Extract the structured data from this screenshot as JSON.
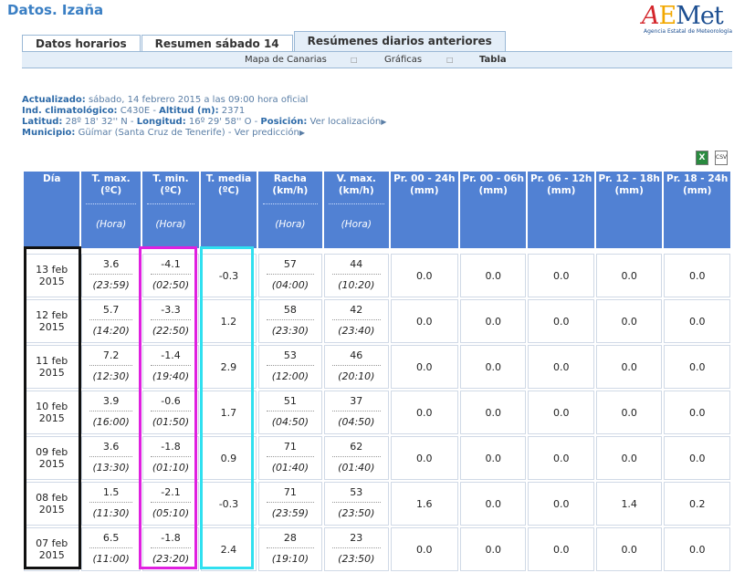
{
  "header": {
    "title": "Datos. Izaña"
  },
  "logo": {
    "sub": "Agencia Estatal de Meteorología"
  },
  "tabs": [
    "Datos horarios",
    "Resumen sábado 14",
    "Resúmenes diarios anteriores"
  ],
  "subnav": {
    "items": [
      "Mapa de Canarias",
      "Gráficas",
      "Tabla"
    ]
  },
  "info": {
    "updated_label": "Actualizado:",
    "updated_value": "sábado, 14 febrero 2015 a las 09:00 hora oficial",
    "ind_label": "Ind. climatológico:",
    "ind_value": "C430E",
    "alt_label": "Altitud (m):",
    "alt_value": "2371",
    "lat_label": "Latitud:",
    "lat_value": "28º 18' 32'' N",
    "lon_label": "Longitud:",
    "lon_value": "16º 29' 58'' O",
    "pos_label": "Posición:",
    "pos_link": "Ver localización",
    "mun_label": "Municipio:",
    "mun_value": "Güímar (Santa Cruz de Tenerife)",
    "pred_link": "Ver predicción"
  },
  "export": {
    "excel": "X",
    "csv": "CSV"
  },
  "table": {
    "headers": {
      "dia": "Día",
      "tmax": "T. max. (ºC)",
      "tmin": "T. min. (ºC)",
      "tmed": "T. media (ºC)",
      "racha": "Racha (km/h)",
      "vmax": "V. max. (km/h)",
      "p1": "Pr. 00 - 24h (mm)",
      "p2": "Pr. 00 - 06h (mm)",
      "p3": "Pr. 06 - 12h (mm)",
      "p4": "Pr. 12 - 18h (mm)",
      "p5": "Pr. 18 - 24h (mm)",
      "hora": "(Hora)"
    },
    "rows": [
      {
        "dia1": "13 feb",
        "dia2": "2015",
        "tmax": "3.6",
        "tmax_h": "(23:59)",
        "tmin": "-4.1",
        "tmin_h": "(02:50)",
        "tmed": "-0.3",
        "racha": "57",
        "racha_h": "(04:00)",
        "vmax": "44",
        "vmax_h": "(10:20)",
        "p1": "0.0",
        "p2": "0.0",
        "p3": "0.0",
        "p4": "0.0",
        "p5": "0.0"
      },
      {
        "dia1": "12 feb",
        "dia2": "2015",
        "tmax": "5.7",
        "tmax_h": "(14:20)",
        "tmin": "-3.3",
        "tmin_h": "(22:50)",
        "tmed": "1.2",
        "racha": "58",
        "racha_h": "(23:30)",
        "vmax": "42",
        "vmax_h": "(23:40)",
        "p1": "0.0",
        "p2": "0.0",
        "p3": "0.0",
        "p4": "0.0",
        "p5": "0.0"
      },
      {
        "dia1": "11 feb",
        "dia2": "2015",
        "tmax": "7.2",
        "tmax_h": "(12:30)",
        "tmin": "-1.4",
        "tmin_h": "(19:40)",
        "tmed": "2.9",
        "racha": "53",
        "racha_h": "(12:00)",
        "vmax": "46",
        "vmax_h": "(20:10)",
        "p1": "0.0",
        "p2": "0.0",
        "p3": "0.0",
        "p4": "0.0",
        "p5": "0.0"
      },
      {
        "dia1": "10 feb",
        "dia2": "2015",
        "tmax": "3.9",
        "tmax_h": "(16:00)",
        "tmin": "-0.6",
        "tmin_h": "(01:50)",
        "tmed": "1.7",
        "racha": "51",
        "racha_h": "(04:50)",
        "vmax": "37",
        "vmax_h": "(04:50)",
        "p1": "0.0",
        "p2": "0.0",
        "p3": "0.0",
        "p4": "0.0",
        "p5": "0.0"
      },
      {
        "dia1": "09 feb",
        "dia2": "2015",
        "tmax": "3.6",
        "tmax_h": "(13:30)",
        "tmin": "-1.8",
        "tmin_h": "(01:10)",
        "tmed": "0.9",
        "racha": "71",
        "racha_h": "(01:40)",
        "vmax": "62",
        "vmax_h": "(01:40)",
        "p1": "0.0",
        "p2": "0.0",
        "p3": "0.0",
        "p4": "0.0",
        "p5": "0.0"
      },
      {
        "dia1": "08 feb",
        "dia2": "2015",
        "tmax": "1.5",
        "tmax_h": "(11:30)",
        "tmin": "-2.1",
        "tmin_h": "(05:10)",
        "tmed": "-0.3",
        "racha": "71",
        "racha_h": "(23:59)",
        "vmax": "53",
        "vmax_h": "(23:50)",
        "p1": "1.6",
        "p2": "0.0",
        "p3": "0.0",
        "p4": "1.4",
        "p5": "0.2"
      },
      {
        "dia1": "07 feb",
        "dia2": "2015",
        "tmax": "6.5",
        "tmax_h": "(11:00)",
        "tmin": "-1.8",
        "tmin_h": "(23:20)",
        "tmed": "2.4",
        "racha": "28",
        "racha_h": "(19:10)",
        "vmax": "23",
        "vmax_h": "(23:50)",
        "p1": "0.0",
        "p2": "0.0",
        "p3": "0.0",
        "p4": "0.0",
        "p5": "0.0"
      }
    ]
  }
}
